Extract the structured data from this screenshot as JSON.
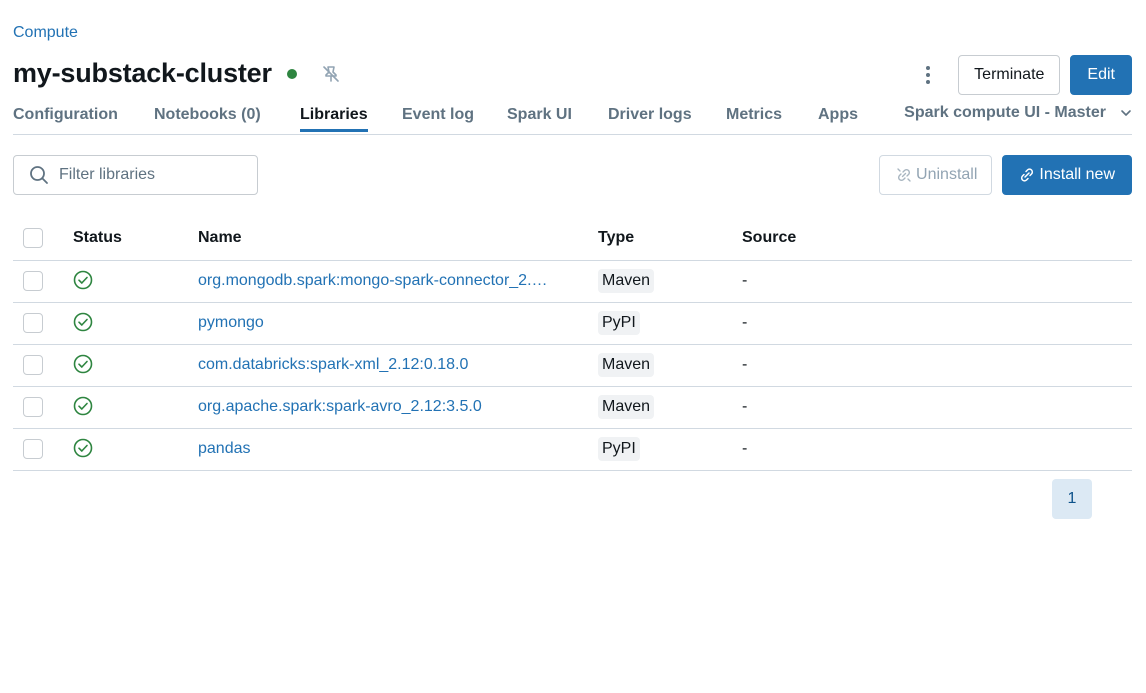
{
  "breadcrumb": {
    "label": "Compute"
  },
  "header": {
    "title": "my-substack-cluster",
    "status_color": "#2e8540",
    "icons": [
      "pin-off-icon",
      "more-vertical-icon"
    ],
    "terminate_label": "Terminate",
    "edit_label": "Edit"
  },
  "tabs": [
    {
      "label": "Configuration",
      "active": false
    },
    {
      "label": "Notebooks (0)",
      "active": false
    },
    {
      "label": "Libraries",
      "active": true
    },
    {
      "label": "Event log",
      "active": false
    },
    {
      "label": "Spark UI",
      "active": false
    },
    {
      "label": "Driver logs",
      "active": false
    },
    {
      "label": "Metrics",
      "active": false
    },
    {
      "label": "Apps",
      "active": false
    }
  ],
  "tab_dropdown": {
    "label": "Spark compute UI - Master"
  },
  "toolbar": {
    "search_placeholder": "Filter libraries",
    "uninstall_label": "Uninstall",
    "install_label": "Install new"
  },
  "table": {
    "columns": {
      "status": "Status",
      "name": "Name",
      "type": "Type",
      "source": "Source"
    },
    "rows": [
      {
        "name": "org.mongodb.spark:mongo-spark-connector_2.…",
        "type": "Maven",
        "source": "-",
        "status": "installed"
      },
      {
        "name": "pymongo",
        "type": "PyPI",
        "source": "-",
        "status": "installed"
      },
      {
        "name": "com.databricks:spark-xml_2.12:0.18.0",
        "type": "Maven",
        "source": "-",
        "status": "installed"
      },
      {
        "name": "org.apache.spark:spark-avro_2.12:3.5.0",
        "type": "Maven",
        "source": "-",
        "status": "installed"
      },
      {
        "name": "pandas",
        "type": "PyPI",
        "source": "-",
        "status": "installed"
      }
    ]
  },
  "pagination": {
    "current": "1"
  },
  "colors": {
    "accent": "#2272b4",
    "success": "#2e8540",
    "muted": "#5f7281"
  }
}
